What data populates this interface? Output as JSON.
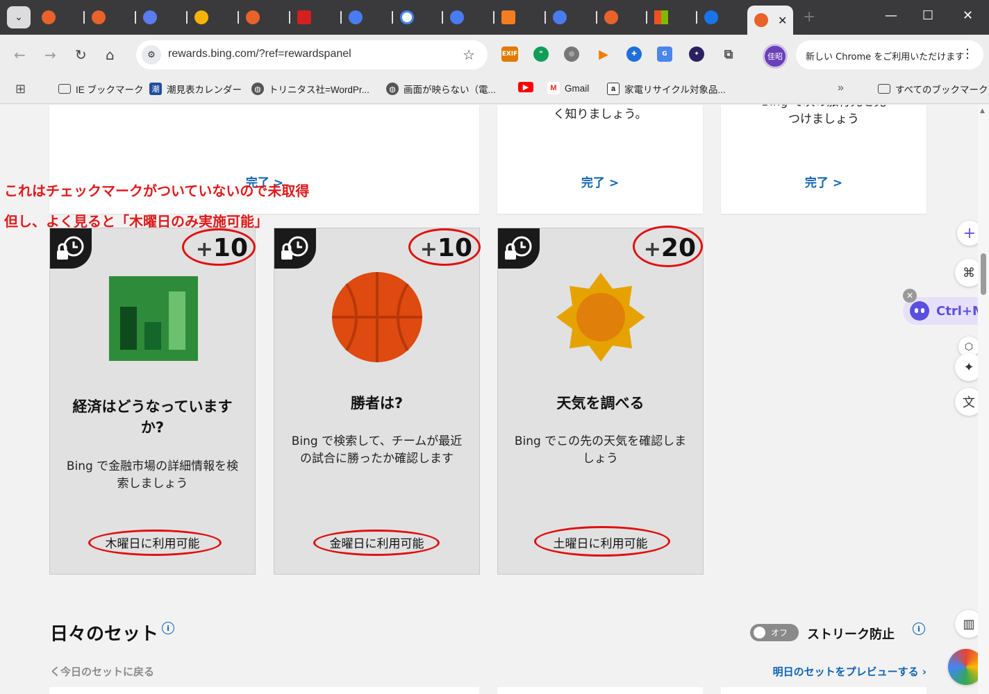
{
  "browser": {
    "url": "rewards.bing.com/?ref=rewardspanel",
    "update_notice": "新しい Chrome をご利用いただけます",
    "profile_initials": "佳昭",
    "tab_close": "✕",
    "new_tab": "+",
    "ext_exif": "EXIF"
  },
  "bookmarks": [
    {
      "label": "IE ブックマーク"
    },
    {
      "label": "潮見表カレンダー"
    },
    {
      "label": "トリニタス社=WordPr..."
    },
    {
      "label": "画面が映らない（電..."
    },
    {
      "label": ""
    },
    {
      "label": "Gmail"
    },
    {
      "label": "家電リサイクル対象品..."
    },
    {
      "label": "すべてのブックマーク"
    }
  ],
  "top_cards": [
    {
      "desc": "",
      "done": "完了 >"
    },
    {
      "desc": "く知りましょう。",
      "done": "完了 >"
    },
    {
      "desc": "Bing で次の旅行先を見つけましょう",
      "done": "完了 >"
    }
  ],
  "annotations": {
    "line1": "これはチェックマークがついていないので未取得",
    "line2": "但し、よく見ると「木曜日のみ実施可能」"
  },
  "cards": [
    {
      "points_plus": "+",
      "points": "10",
      "title": "経済はどうなっていますか?",
      "body": "Bing で金融市場の詳細情報を検索しましょう",
      "availability": "木曜日に利用可能"
    },
    {
      "points_plus": "+",
      "points": "10",
      "title": "勝者は?",
      "body": "Bing で検索して、チームが最近の試合に勝ったか確認します",
      "availability": "金曜日に利用可能"
    },
    {
      "points_plus": "+",
      "points": "20",
      "title": "天気を調べる",
      "body": "Bing でこの先の天気を確認しましょう",
      "availability": "土曜日に利用可能"
    }
  ],
  "daily_set": {
    "title": "日々のセット",
    "toggle_label": "オフ",
    "streak_label": "ストリーク防止",
    "back_link": "く今日のセットに戻る",
    "preview_link": "明日のセットをプレビューする",
    "info_glyph": "i"
  },
  "side_widget": {
    "shortcut": "Ctrl+M"
  },
  "colors": {
    "link_blue": "#0e63b5",
    "annotation_red": "#e0191a",
    "card_bg": "#e1e1e1"
  }
}
